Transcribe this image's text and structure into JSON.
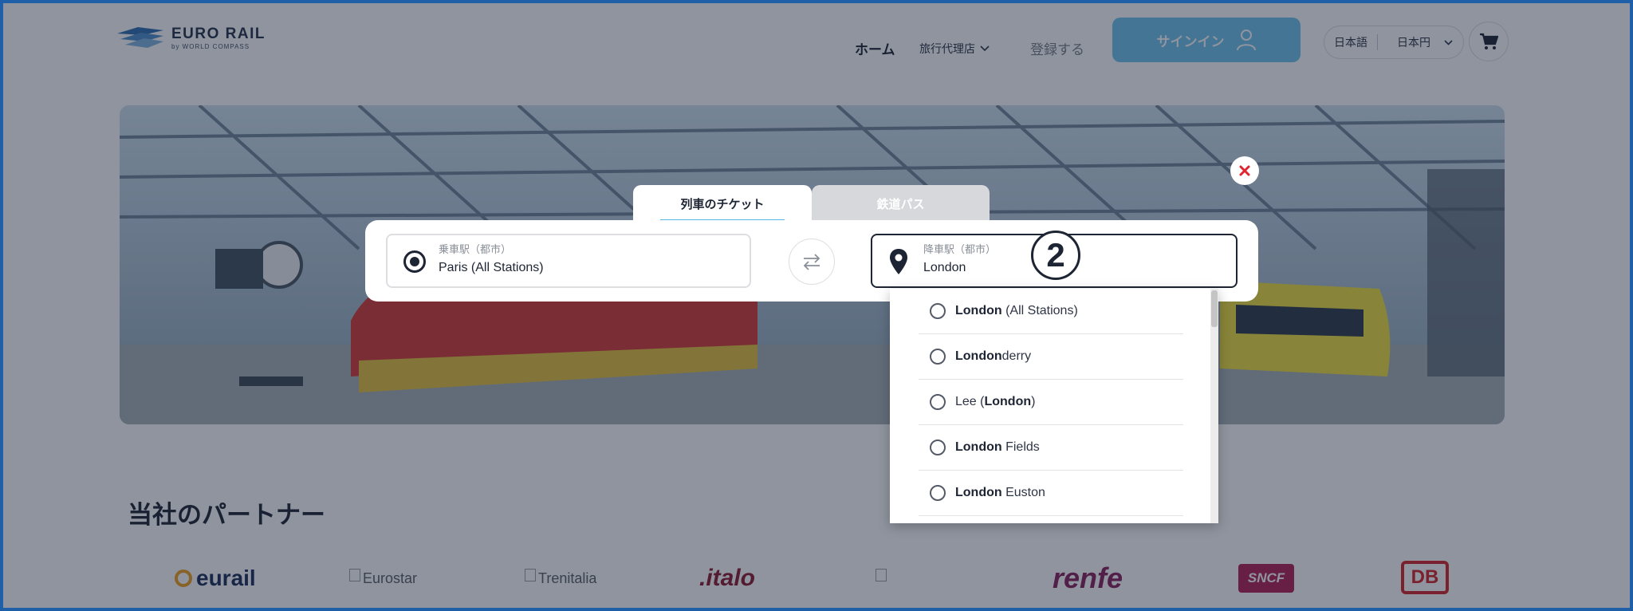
{
  "header": {
    "logo_main": "EURO RAIL",
    "logo_sub": "by WORLD COMPASS",
    "nav_home": "ホーム",
    "nav_agent": "旅行代理店",
    "nav_register": "登録する",
    "signin_label": "サインイン",
    "language": "日本語",
    "currency": "日本円"
  },
  "modal": {
    "tabs": [
      {
        "label": "列車のチケット",
        "active": true
      },
      {
        "label": "鉄道パス",
        "active": false
      }
    ],
    "from": {
      "label": "乗車駅（都市）",
      "value": "Paris (All Stations)"
    },
    "to": {
      "label": "降車駅（都市）",
      "value": "London"
    },
    "step_badge": "2",
    "suggestions": [
      {
        "pre": "",
        "bold": "London",
        "post": " (All Stations)"
      },
      {
        "pre": "",
        "bold": "London",
        "post": "derry"
      },
      {
        "pre": "Lee (",
        "bold": "London",
        "post": ")"
      },
      {
        "pre": "",
        "bold": "London",
        "post": " Fields"
      },
      {
        "pre": "",
        "bold": "London",
        "post": " Euston"
      }
    ]
  },
  "partners": {
    "title": "当社のパートナー",
    "logos": [
      "eurail",
      "Eurostar",
      "Trenitalia",
      ".italo",
      "renfe",
      "SNCF",
      "DB"
    ]
  },
  "colors": {
    "accent": "#6fc3ee",
    "overlay": "#142034",
    "close": "#e0242f",
    "frame": "#1f5fa8"
  },
  "icons": {
    "close": "close-icon",
    "swap": "swap-arrows-icon",
    "pin": "map-pin-icon",
    "cart": "cart-icon",
    "user": "user-icon",
    "chevron": "chevron-down-icon"
  }
}
